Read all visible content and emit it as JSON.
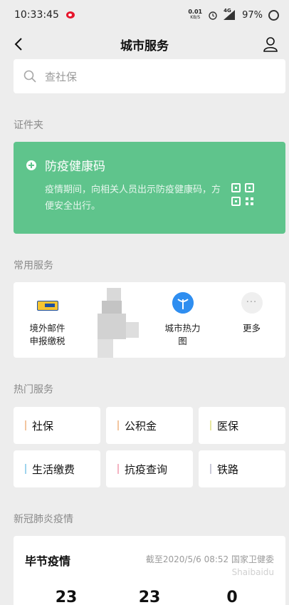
{
  "status_bar": {
    "time": "10:33:45",
    "net_speed_value": "0.01",
    "net_speed_unit": "KB/S",
    "network": "4G",
    "battery": "97%"
  },
  "nav": {
    "title": "城市服务"
  },
  "search": {
    "placeholder": "查社保"
  },
  "documents": {
    "section_title": "证件夹",
    "health_code": {
      "title": "防疫健康码",
      "description": "疫情期间，向相关人员出示防疫健康码，方便安全出行。",
      "accent_color": "#5fc48c"
    }
  },
  "common_services": {
    "section_title": "常用服务",
    "items": [
      {
        "label": "境外邮件\n申报缴税",
        "icon": "mail-tax-icon"
      },
      {
        "label": "",
        "icon": "pixelated-icon"
      },
      {
        "label": "城市热力\n图",
        "icon": "city-heatmap-icon"
      },
      {
        "label": "更多",
        "icon": "more-icon"
      }
    ]
  },
  "hot_services": {
    "section_title": "热门服务",
    "items": [
      {
        "label": "社保",
        "bar_color": "#f3c6a0"
      },
      {
        "label": "公积金",
        "bar_color": "#f3c6a0"
      },
      {
        "label": "医保",
        "bar_color": "#e6e6a0"
      },
      {
        "label": "生活缴费",
        "bar_color": "#9fd4ee"
      },
      {
        "label": "抗疫查询",
        "bar_color": "#f4b3c2"
      },
      {
        "label": "铁路",
        "bar_color": "#c9c9d8"
      }
    ]
  },
  "covid": {
    "section_title": "新冠肺炎疫情",
    "title": "毕节疫情",
    "source": "截至2020/5/6 08:52 国家卫健委",
    "watermark": "Shaibaidu",
    "numbers": [
      "23",
      "23",
      "0"
    ]
  }
}
